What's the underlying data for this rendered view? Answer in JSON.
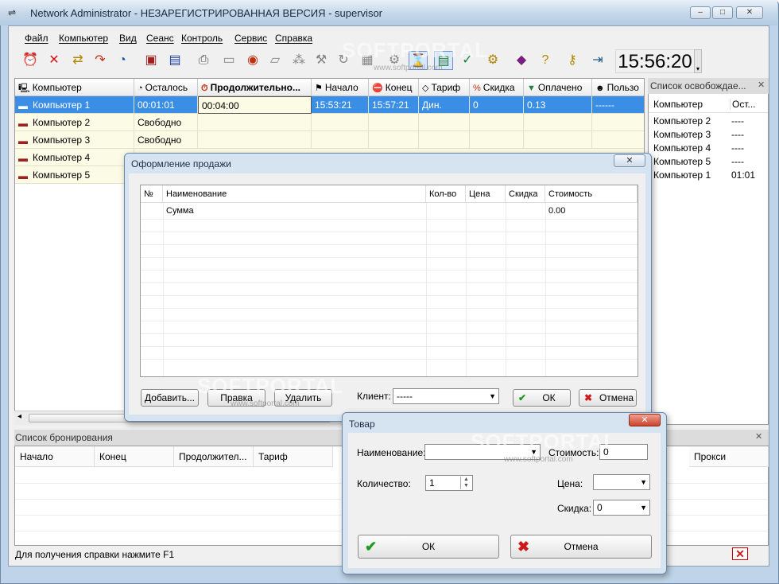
{
  "window": {
    "title": "Network Administrator - НЕЗАРЕГИСТРИРОВАННАЯ ВЕРСИЯ - supervisor",
    "minimize": "–",
    "maximize": "□",
    "close": "✕"
  },
  "menu": [
    "Файл",
    "Компьютер",
    "Вид",
    "Сеанс",
    "Контроль",
    "Сервис",
    "Справка"
  ],
  "clock": "15:56:20",
  "grid": {
    "headers": [
      "Компьютер",
      "Осталось",
      "Продолжительно...",
      "Начало",
      "Конец",
      "Тариф",
      "Скидка",
      "Оплачено",
      "Пользо"
    ],
    "rows": [
      {
        "name": "Компьютер 1",
        "left": "00:01:01",
        "duration": "00:04:00",
        "start": "15:53:21",
        "end": "15:57:21",
        "tariff": "Дин.",
        "discount": "0",
        "paid": "0.13",
        "user": "------"
      },
      {
        "name": "Компьютер 2",
        "left": "Свободно"
      },
      {
        "name": "Компьютер 3",
        "left": "Свободно"
      },
      {
        "name": "Компьютер 4",
        "left": ""
      },
      {
        "name": "Компьютер 5",
        "left": ""
      }
    ]
  },
  "free_panel": {
    "title": "Список освобождае...",
    "close": "✕",
    "col1": "Компьютер",
    "col2": "Ост...",
    "rows": [
      {
        "name": "Компьютер 2",
        "value": "----"
      },
      {
        "name": "Компьютер 3",
        "value": "----"
      },
      {
        "name": "Компьютер 4",
        "value": "----"
      },
      {
        "name": "Компьютер 5",
        "value": "----"
      },
      {
        "name": "Компьютер 1",
        "value": "01:01"
      }
    ]
  },
  "booking": {
    "title": "Список бронирования",
    "close": "✕",
    "headers": [
      "Начало",
      "Конец",
      "Продолжител...",
      "Тариф",
      "Прокси"
    ]
  },
  "status": "Для получения справки нажмите F1",
  "sale_dialog": {
    "title": "Оформление продажи",
    "close": "✕",
    "headers": [
      "№",
      "Наименование",
      "Кол-во",
      "Цена",
      "Скидка",
      "Стоимость"
    ],
    "rows": [
      {
        "name": "Сумма",
        "cost": "0.00"
      }
    ],
    "add": "Добавить...",
    "edit": "Правка",
    "delete": "Удалить",
    "client_label": "Клиент:",
    "client_value": "-----",
    "ok": "ОК",
    "cancel": "Отмена"
  },
  "product_dialog": {
    "title": "Товар",
    "close": "✕",
    "name_label": "Наименование:",
    "name_value": "",
    "cost_label": "Стоимость:",
    "cost_value": "0",
    "qty_label": "Количество:",
    "qty_value": "1",
    "price_label": "Цена:",
    "price_value": "",
    "discount_label": "Скидка:",
    "discount_value": "0",
    "ok": "ОК",
    "cancel": "Отмена"
  },
  "watermark": "SOFTPORTAL",
  "watermark_url": "www.softportal.com"
}
